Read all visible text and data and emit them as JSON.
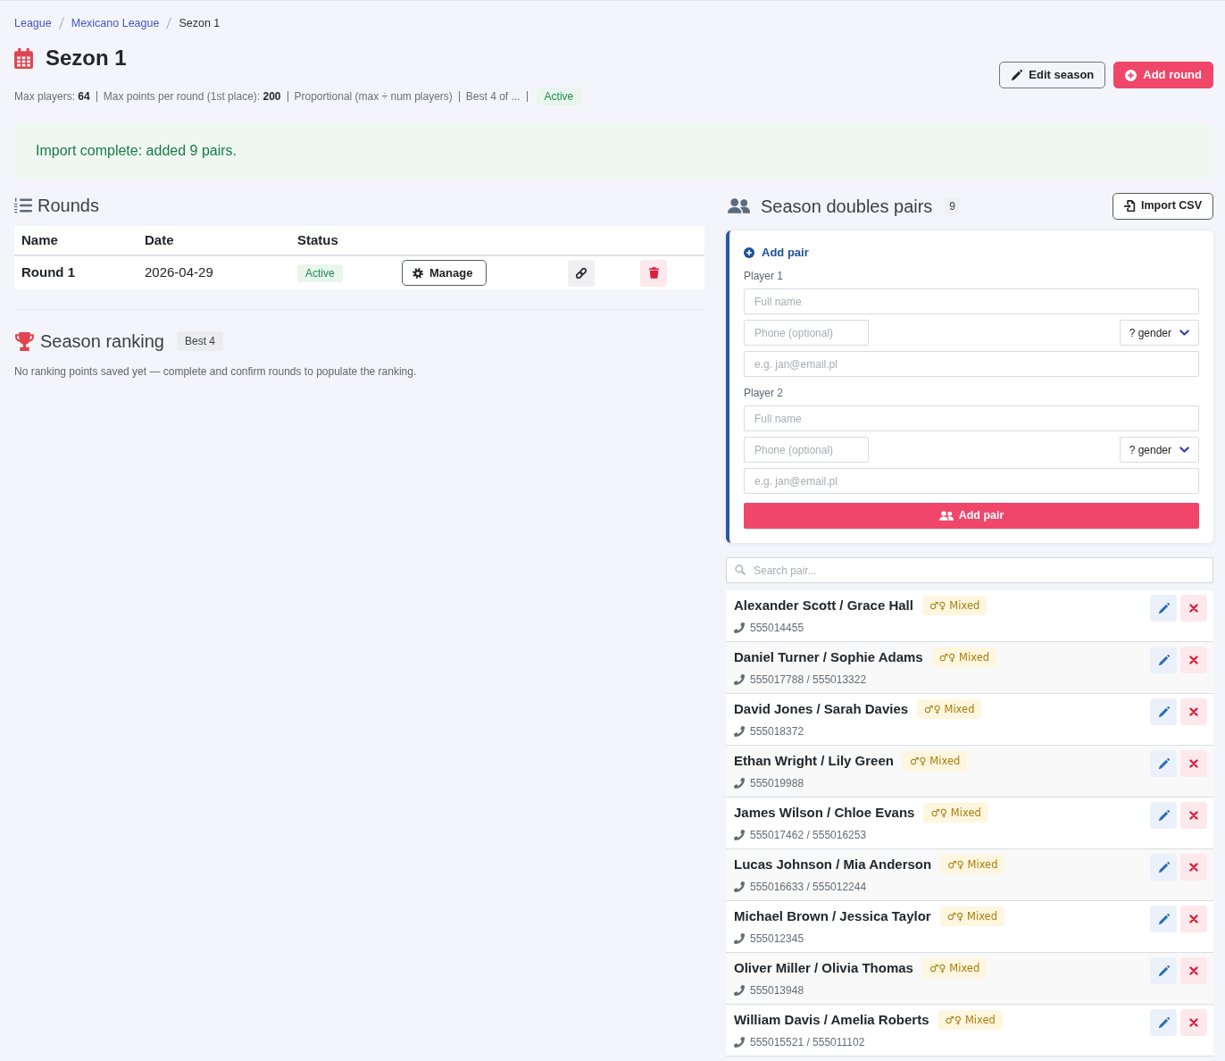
{
  "breadcrumb": [
    {
      "label": "League",
      "current": false
    },
    {
      "label": "Mexicano League",
      "current": false
    },
    {
      "label": "Sezon 1",
      "current": true
    }
  ],
  "header": {
    "title": "Sezon 1",
    "meta": [
      "Max players: **64**",
      "Max points per round (1st place): **200**",
      "Proportional (max ÷ num players)",
      "Best 4 of ..."
    ],
    "status": "Active",
    "buttons": [
      {
        "label": "Edit season",
        "kind": "outline"
      },
      {
        "label": "Add round",
        "kind": "primary"
      }
    ]
  },
  "alert": {
    "text": "Import complete: added 9 pairs."
  },
  "rounds": {
    "title": "Rounds",
    "columns": [
      "Name",
      "Date",
      "Status"
    ],
    "rows": [
      {
        "name": "Round 1",
        "date": "2026-04-29",
        "status": "Active",
        "manage": "Manage"
      }
    ]
  },
  "ranking": {
    "title": "Season ranking",
    "badge": "Best 4",
    "empty_text": "No ranking points saved yet — complete and confirm rounds to populate the ranking."
  },
  "pairs": {
    "title": "Season doubles pairs",
    "count": "9",
    "import_button": "Import CSV",
    "form": {
      "title": "Add pair",
      "players": [
        {
          "label": "Player 1",
          "name_placeholder": "Full name",
          "phone_placeholder": "Phone (optional)",
          "gender": "? gender",
          "email_placeholder": "e.g. jan@email.pl"
        },
        {
          "label": "Player 2",
          "name_placeholder": "Full name",
          "phone_placeholder": "Phone (optional)",
          "gender": "? gender",
          "email_placeholder": "e.g. jan@email.pl"
        }
      ],
      "submit": "Add pair"
    },
    "search_placeholder": "Search pair...",
    "items": [
      {
        "names": "Alexander Scott / Grace Hall",
        "category": "♂♀ Mixed",
        "phones": "555014455"
      },
      {
        "names": "Daniel Turner / Sophie Adams",
        "category": "♂♀ Mixed",
        "phones": "555017788 / 555013322"
      },
      {
        "names": "David Jones / Sarah Davies",
        "category": "♂♀ Mixed",
        "phones": "555018372"
      },
      {
        "names": "Ethan Wright / Lily Green",
        "category": "♂♀ Mixed",
        "phones": "555019988"
      },
      {
        "names": "James Wilson / Chloe Evans",
        "category": "♂♀ Mixed",
        "phones": "555017462 / 555016253"
      },
      {
        "names": "Lucas Johnson / Mia Anderson",
        "category": "♂♀ Mixed",
        "phones": "555016633 / 555012244"
      },
      {
        "names": "Michael Brown / Jessica Taylor",
        "category": "♂♀ Mixed",
        "phones": "555012345"
      },
      {
        "names": "Oliver Miller / Olivia Thomas",
        "category": "♂♀ Mixed",
        "phones": "555013948"
      },
      {
        "names": "William Davis / Amelia Roberts",
        "category": "♂♀ Mixed",
        "phones": "555015521 / 555011102"
      }
    ]
  }
}
